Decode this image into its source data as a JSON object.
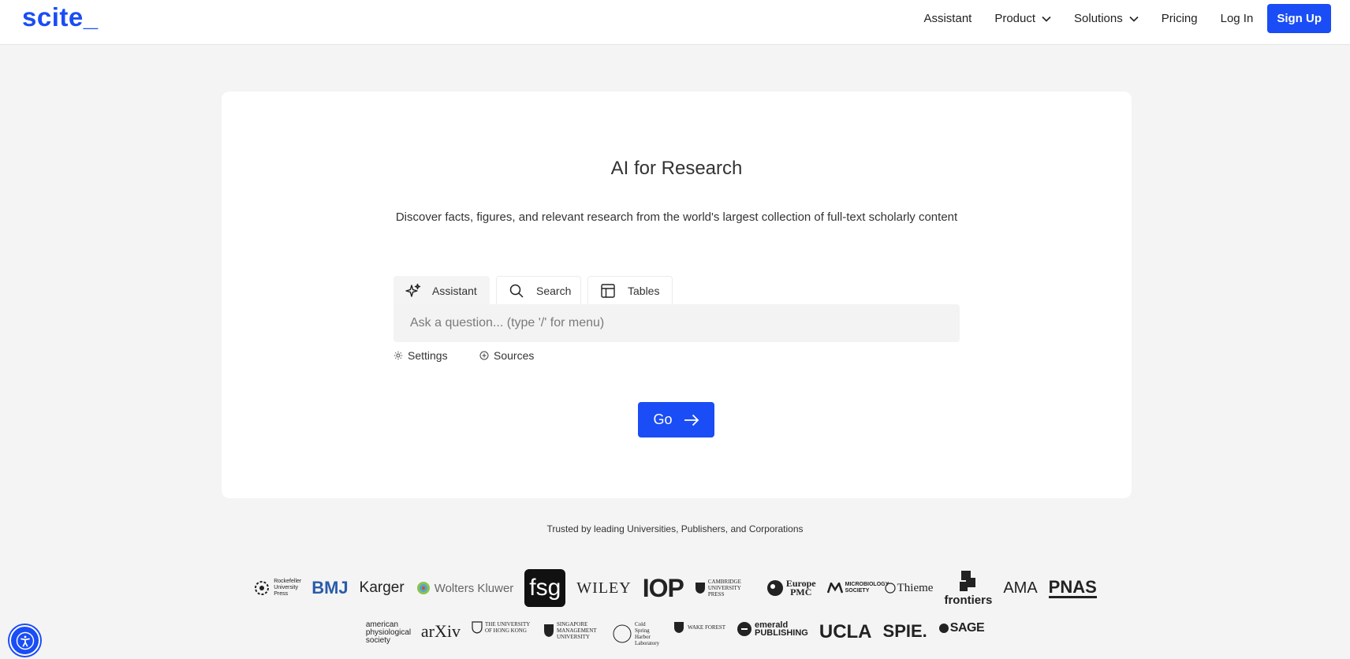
{
  "brand": "scite_",
  "nav": {
    "assistant": "Assistant",
    "product": "Product",
    "solutions": "Solutions",
    "pricing": "Pricing",
    "login": "Log In",
    "signup": "Sign Up"
  },
  "hero": {
    "title": "AI for Research",
    "subtitle": "Discover facts, figures, and relevant research from the world's largest collection of full-text scholarly content"
  },
  "tabs": {
    "assistant": "Assistant",
    "search": "Search",
    "tables": "Tables"
  },
  "query": {
    "placeholder": "Ask a question... (type '/' for menu)",
    "value": ""
  },
  "options": {
    "settings": "Settings",
    "sources": "Sources"
  },
  "go_label": "Go",
  "trusted": {
    "heading": "Trusted by leading Universities, Publishers, and Corporations",
    "row1": {
      "rockefeller": "Rockefeller University Press",
      "bmj": "BMJ",
      "karger": "Karger",
      "wolters": "Wolters Kluwer",
      "fsg": "fsg",
      "wiley": "WILEY",
      "iop": "IOP",
      "cambridge": "CAMBRIDGE UNIVERSITY PRESS",
      "europe_pmc_1": "Europe",
      "europe_pmc_2": "PMC",
      "microbiology": "MICROBIOLOGY SOCIETY",
      "thieme": "Thieme",
      "frontiers": "frontiers",
      "ama": "AMA",
      "pnas": "PNAS"
    },
    "row2": {
      "aps": "american physiological society",
      "arxiv": "arXiv",
      "hku": "THE UNIVERSITY OF HONG KONG",
      "smu": "SINGAPORE MANAGEMENT UNIVERSITY",
      "csh": "Cold Spring Harbor Laboratory",
      "wake": "WAKE FOREST",
      "emerald_1": "emerald",
      "emerald_2": "PUBLISHING",
      "ucla": "UCLA",
      "spie": "SPIE.",
      "sage": "SAGE"
    }
  },
  "colors": {
    "brand_blue": "#1a4df5",
    "page_bg": "#f4f4f4",
    "card_bg": "#ffffff"
  },
  "icons": {
    "assistant_tab": "sparkles-icon",
    "search_tab": "magnifier-icon",
    "tables_tab": "table-layout-icon",
    "settings": "gear-icon",
    "sources": "plus-circle-icon",
    "go": "arrow-right-icon",
    "dropdown": "chevron-down-icon",
    "accessibility": "accessibility-person-icon"
  }
}
